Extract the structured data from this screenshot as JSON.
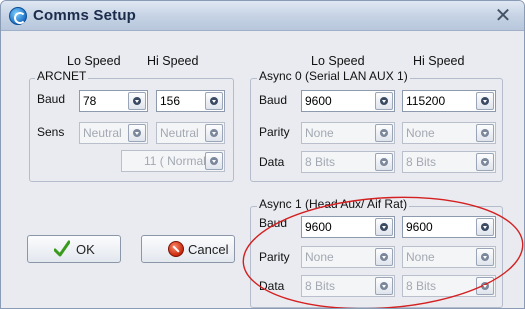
{
  "window": {
    "title": "Comms Setup",
    "close_glyph": "✕"
  },
  "headers": {
    "left_lo": "Lo Speed",
    "left_hi": "Hi Speed",
    "right_lo": "Lo Speed",
    "right_hi": "Hi Speed"
  },
  "arcnet": {
    "title": "ARCNET",
    "baud_label": "Baud",
    "baud_lo": "78",
    "baud_hi": "156",
    "sens_label": "Sens",
    "sens_lo": "Neutral",
    "sens_hi": "Neutral",
    "node": "11 ( Normal)"
  },
  "async0": {
    "title": "Async 0 (Serial LAN AUX 1)",
    "baud_label": "Baud",
    "baud_lo": "9600",
    "baud_hi": "115200",
    "parity_label": "Parity",
    "parity_lo": "None",
    "parity_hi": "None",
    "data_label": "Data",
    "data_lo": "8 Bits",
    "data_hi": "8 Bits"
  },
  "async1": {
    "title": "Async 1 (Head Aux/ Aif Rat)",
    "baud_label": "Baud",
    "baud_lo": "9600",
    "baud_hi": "9600",
    "parity_label": "Parity",
    "parity_lo": "None",
    "parity_hi": "None",
    "data_label": "Data",
    "data_lo": "8 Bits",
    "data_hi": "8 Bits"
  },
  "buttons": {
    "ok": "OK",
    "cancel": "Cancel"
  },
  "colors": {
    "annotation_oval": "#d42020",
    "ok_check": "#3a9a1c"
  }
}
